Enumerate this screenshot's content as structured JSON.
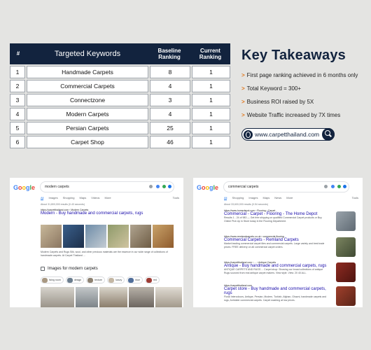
{
  "table": {
    "headers": {
      "num": "#",
      "keyword": "Targeted Keywords",
      "baseline": "Baseline Ranking",
      "current": "Current Ranking"
    },
    "rows": [
      {
        "num": "1",
        "keyword": "Handmade Carpets",
        "baseline": "8",
        "current": "1"
      },
      {
        "num": "2",
        "keyword": "Commercial Carpets",
        "baseline": "4",
        "current": "1"
      },
      {
        "num": "3",
        "keyword": "Connectzone",
        "baseline": "3",
        "current": "1"
      },
      {
        "num": "4",
        "keyword": "Modern Carpets",
        "baseline": "4",
        "current": "1"
      },
      {
        "num": "5",
        "keyword": "Persian Carpets",
        "baseline": "25",
        "current": "1"
      },
      {
        "num": "6",
        "keyword": "Carpet Shop",
        "baseline": "46",
        "current": "1"
      }
    ]
  },
  "takeaways": {
    "title": "Key Takeaways",
    "items": [
      "First page ranking achieved in 6 months only",
      "Total Keyword = 300+",
      "Business ROI raised by 5X",
      "Website Traffic increased by 7X times"
    ],
    "bullet": ">",
    "website": "www.carpetthailand.com"
  },
  "serp_left": {
    "logo": "Google",
    "query": "modern carpets",
    "tabs": [
      "All",
      "Images",
      "Shopping",
      "Maps",
      "Videos",
      "More"
    ],
    "tools": "Tools",
    "stats": "About 31,800,000 results (0.43 seconds)",
    "result": {
      "url": "https://carpetthailand.com › Modern Carpets",
      "title": "Modern - Buy handmade and commercial carpets, rugs",
      "snippet": "Modern Carpets and Rugs Silk, wool, and other precious materials are the essence in our wide range of collections of handmade carpets. At Carpet Thailand ..."
    },
    "images_title": "Images for modern carpets",
    "chips": [
      "living room",
      "design",
      "texture",
      "luxury",
      "blue",
      "red"
    ],
    "colors": {
      "link": "#1a0dab",
      "accent": "#1a73e8"
    }
  },
  "serp_right": {
    "logo": "Google",
    "query": "commercial carpets",
    "tabs": [
      "All",
      "Shopping",
      "Images",
      "Maps",
      "News",
      "More"
    ],
    "tools": "Tools",
    "stats": "About 33,600,000 results (0.54 seconds)",
    "results": [
      {
        "url": "https://www.homedepot.com › Flooring › Carpet",
        "title": "Commercial - Carpet - Flooring - The Home Depot",
        "snippet": "Results 1 - 24 of 983 — Get free shipping on qualified Commercial Carpet products or Buy Online Pick Up in Store today in the Flooring Department."
      },
      {
        "url": "https://www.remlandcarpets.co.uk › commercial-flooring",
        "title": "Commercial Carpets - Remland Carpets",
        "snippet": "Market leading commercial carpet tiles and commercial carpets. Large variety and best trade prices. FREE delivery on all commercial carpet orders."
      },
      {
        "url": "https://carpetthailand.com › ... › Antique Carpets",
        "title": "Antique - Buy handmade and commercial carpets, rugs",
        "snippet": "ANTIQUE CARPETS AND RUGS ... Carpet shop: Showing our broad collections of antique Rugs sourced from real antique carpet makers. View style. View: 20 40 ALL."
      },
      {
        "url": "https://carpetthailand.com",
        "title": "Carpet store - Buy handmade and commercial carpets, rugs",
        "snippet": "Floral Intercolours, Antique, Persian, Modern, Turkish, Afghan, Ghazni, handmade carpets and rugs, Anhidder commercial carpets. Carpet washing at low prices."
      }
    ]
  }
}
